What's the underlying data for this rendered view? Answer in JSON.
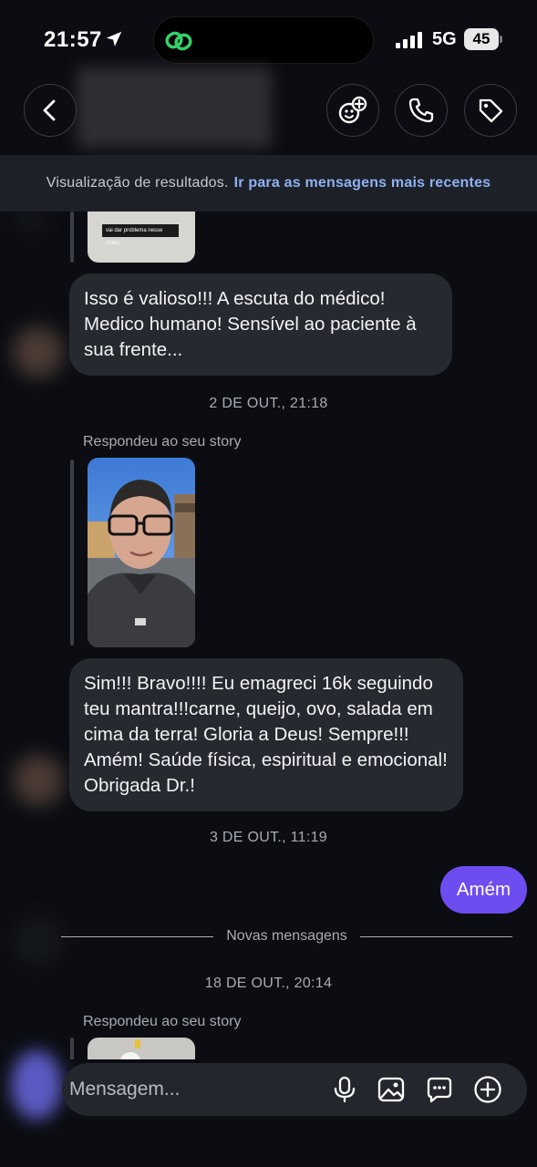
{
  "status_bar": {
    "time": "21:57",
    "network": "5G",
    "battery": "45"
  },
  "header": {
    "icons": [
      "back-icon",
      "remix-icon",
      "phone-icon",
      "tag-icon"
    ]
  },
  "banner": {
    "text": "Visualização de resultados.",
    "link": "Ir para as mensagens mais recentes"
  },
  "messages": {
    "msg1": "Isso é valioso!!! A escuta do médico! Medico humano! Sensível ao paciente à sua frente...",
    "ts1": "2 DE OUT., 21:18",
    "reply1": "Respondeu ao seu story",
    "msg2": "Sim!!! Bravo!!!! Eu emagreci 16k seguindo teu mantra!!!carne, queijo, ovo, salada em cima da terra! Gloria a Deus! Sempre!!! Amém! Saúde física, espiritual e emocional! Obrigada Dr.!",
    "ts2": "3 DE OUT., 11:19",
    "sent1": "Amém",
    "divider": "Novas mensagens",
    "ts3": "18 DE OUT., 20:14",
    "reply2": "Respondeu ao seu story",
    "thumb_caption": "vai dar problema nesse vídeo."
  },
  "composer": {
    "placeholder": "Mensagem..."
  },
  "colors": {
    "background": "#0b0d12",
    "bubble_in": "#262930",
    "bubble_out": "#6e4df0",
    "link": "#8fb1f2"
  }
}
